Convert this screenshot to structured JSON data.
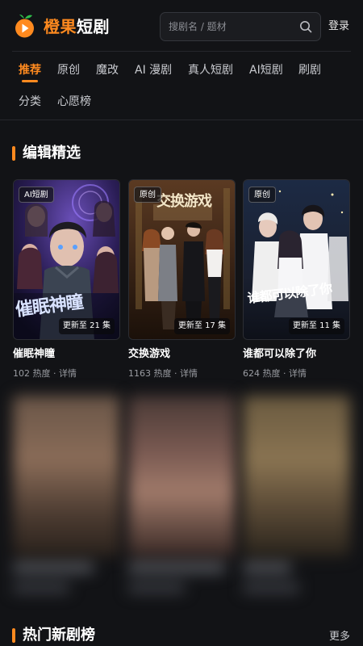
{
  "app": {
    "brand_part1": "橙果",
    "brand_part2": "短剧"
  },
  "header": {
    "search_placeholder": "搜剧名 / 题材",
    "login_label": "登录"
  },
  "nav": {
    "tabs": [
      {
        "label": "推荐",
        "active": true
      },
      {
        "label": "原创"
      },
      {
        "label": "魔改"
      },
      {
        "label": "AI 漫剧"
      },
      {
        "label": "真人短剧"
      },
      {
        "label": "AI短剧"
      },
      {
        "label": "刷剧"
      },
      {
        "label": "分类"
      },
      {
        "label": "心愿榜"
      }
    ]
  },
  "sections": {
    "editor_picks": {
      "title": "编辑精选",
      "cards": [
        {
          "tag": "AI短剧",
          "poster_text": "催眠神瞳",
          "episodes": "更新至 21 集",
          "title": "催眠神瞳",
          "meta": "102 热度 · 详情"
        },
        {
          "tag": "原创",
          "poster_text": "交换游戏",
          "episodes": "更新至 17 集",
          "title": "交换游戏",
          "meta": "1163 热度 · 详情"
        },
        {
          "tag": "原创",
          "poster_text": "谁都可以除了你",
          "episodes": "更新至 11 集",
          "title": "谁都可以除了你",
          "meta": "624 热度 · 详情"
        }
      ]
    },
    "hot_ranking": {
      "title": "热门新剧榜",
      "more_label": "更多"
    }
  },
  "colors": {
    "accent": "#ff8a1f",
    "background": "#121316"
  }
}
